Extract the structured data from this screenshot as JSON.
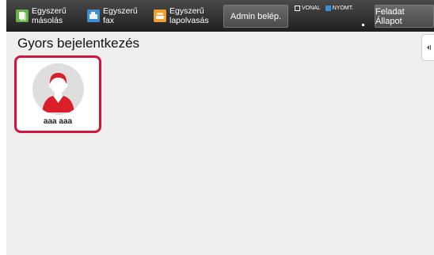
{
  "colors": {
    "topbar": "#2b2b2b",
    "accent_red": "#d0173b",
    "copy_icon": "#6ab04c",
    "fax_icon": "#3d8fd6",
    "scan_icon": "#f0a030",
    "status_blue": "#3d8fd6"
  },
  "topbar": {
    "items": [
      {
        "label_line1": "Egyszerű",
        "label_line2": "másolás",
        "icon": "copy-icon"
      },
      {
        "label_line1": "Egyszerű",
        "label_line2": "fax",
        "icon": "fax-icon"
      },
      {
        "label_line1": "Egyszerű",
        "label_line2": "lapolvasás",
        "icon": "scan-icon"
      }
    ],
    "admin_button": "Admin belép.",
    "status": {
      "line": "VONAL",
      "print": "NYOMT."
    },
    "job_status_button": "Feladat Állapot"
  },
  "page": {
    "title": "Gyors bejelentkezés"
  },
  "users": [
    {
      "name": "aaa aaa",
      "icon": "user-avatar-icon"
    }
  ]
}
